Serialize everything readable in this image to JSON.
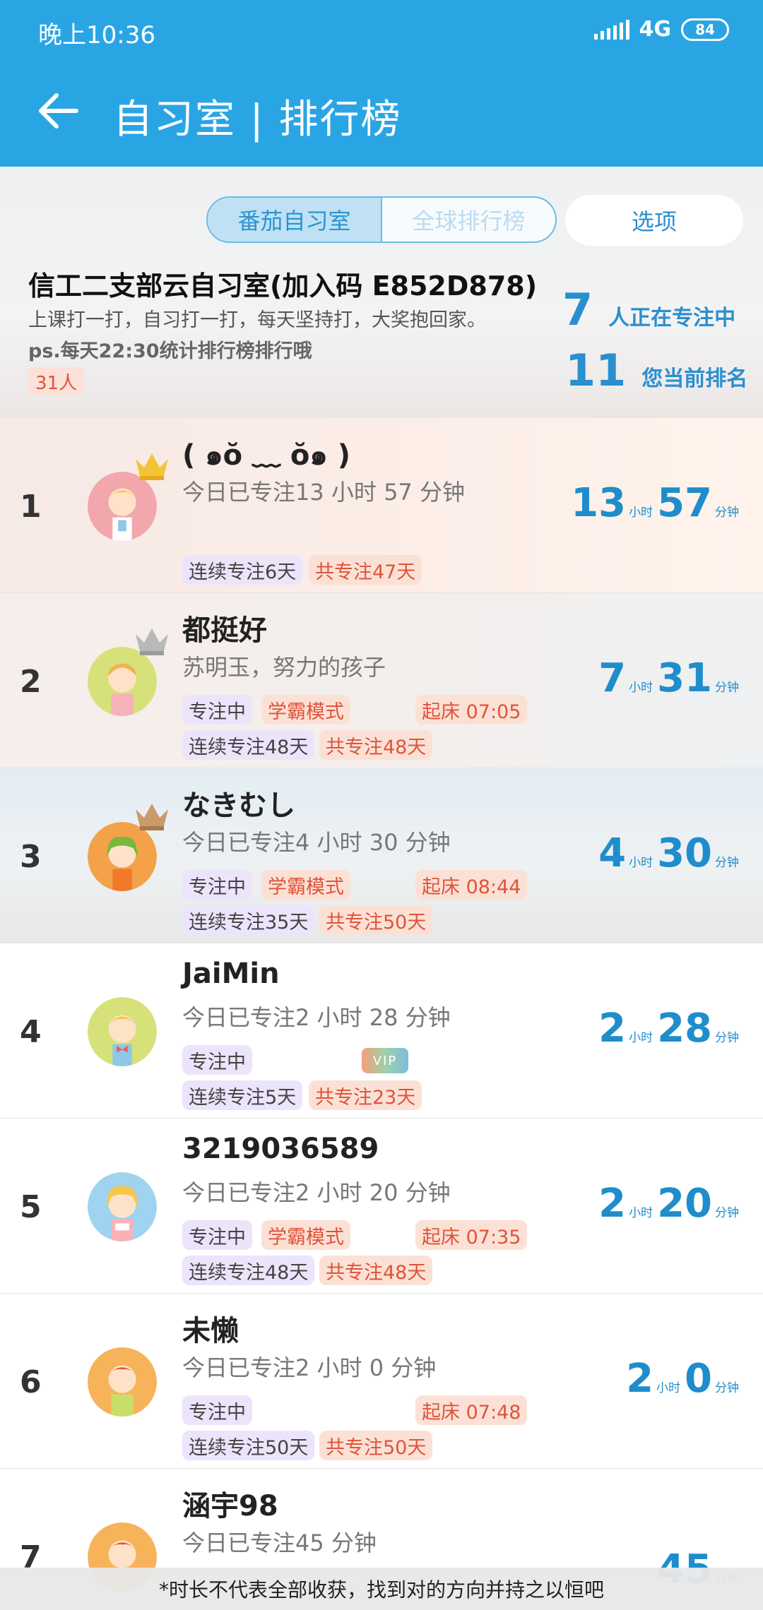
{
  "status": {
    "time": "晚上10:36",
    "network": "4G",
    "battery": "84"
  },
  "appbar": {
    "title": "自习室 | 排行榜"
  },
  "tabs": {
    "pomodoro_room": "番茄自习室",
    "global_rank": "全球排行榜",
    "options": "选项"
  },
  "room": {
    "title": "信工二支部云自习室(加入码 E852D878)",
    "desc1": "上课打一打，自习打一打，每天坚持打，大奖抱回家。",
    "desc2": "ps.每天22:30统计排行榜排行哦",
    "members": "31人",
    "focusing_count": "7",
    "focusing_label": "人正在专注中",
    "my_rank": "11",
    "my_rank_label": "您当前排名"
  },
  "units": {
    "hour": "小时",
    "minute": "分钟"
  },
  "rows": [
    {
      "rank": "1",
      "name": "( ๑ŏ ﹏ ŏ๑ )",
      "today": "今日已专注13 小时 57 分钟",
      "hours": "13",
      "minutes": "57",
      "tags": [],
      "streak": "连续专注6天",
      "total": "共专注47天",
      "wake": ""
    },
    {
      "rank": "2",
      "name": "都挺好",
      "today": "苏明玉，努力的孩子",
      "hours": "7",
      "minutes": "31",
      "tags": [
        "专注中",
        "学霸模式"
      ],
      "streak": "连续专注48天",
      "total": "共专注48天",
      "wake": "起床 07:05"
    },
    {
      "rank": "3",
      "name": "なきむし",
      "today": "今日已专注4 小时 30 分钟",
      "hours": "4",
      "minutes": "30",
      "tags": [
        "专注中",
        "学霸模式"
      ],
      "streak": "连续专注35天",
      "total": "共专注50天",
      "wake": "起床 08:44"
    },
    {
      "rank": "4",
      "name": "JaiMin",
      "today": "今日已专注2 小时 28 分钟",
      "hours": "2",
      "minutes": "28",
      "tags": [
        "专注中"
      ],
      "vip": "VIP",
      "streak": "连续专注5天",
      "total": "共专注23天",
      "wake": ""
    },
    {
      "rank": "5",
      "name": "3219036589",
      "today": "今日已专注2 小时 20 分钟",
      "hours": "2",
      "minutes": "20",
      "tags": [
        "专注中",
        "学霸模式"
      ],
      "streak": "连续专注48天",
      "total": "共专注48天",
      "wake": "起床 07:35"
    },
    {
      "rank": "6",
      "name": "未懒",
      "today": "今日已专注2 小时 0 分钟",
      "hours": "2",
      "minutes": "0",
      "tags": [
        "专注中"
      ],
      "streak": "连续专注50天",
      "total": "共专注50天",
      "wake": "起床 07:48"
    },
    {
      "rank": "7",
      "name": "涵宇98",
      "today": "今日已专注45 分钟",
      "minutes": "45"
    }
  ],
  "footer": "*时长不代表全部收获，找到对的方向并持之以恒吧",
  "colors": {
    "primary": "#2aa5e4",
    "accent_text": "#1f8dcb",
    "tag_orange": "#e0533a",
    "tag_purple_bg": "#ece4fb"
  }
}
